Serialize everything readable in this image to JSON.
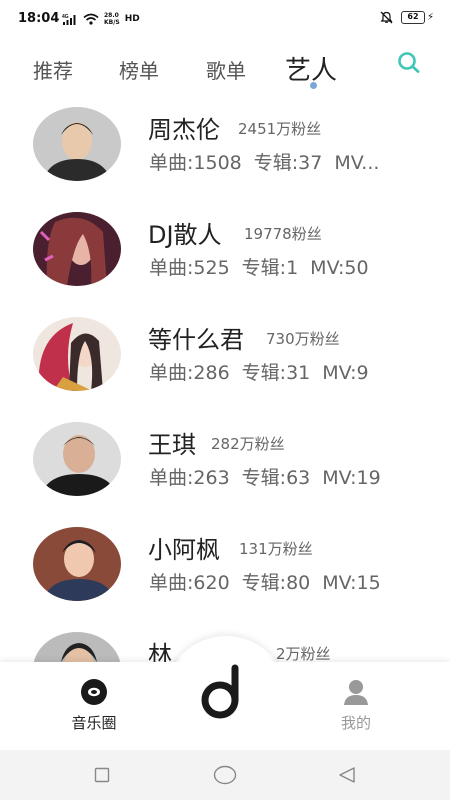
{
  "status_bar": {
    "time": "18:04",
    "network_type": "4G",
    "speed_value": "28.0",
    "speed_unit": "KB/S",
    "hd_label": "HD",
    "battery": "62"
  },
  "tabs": [
    {
      "label": "推荐",
      "active": false
    },
    {
      "label": "榜单",
      "active": false
    },
    {
      "label": "歌单",
      "active": false
    },
    {
      "label": "艺人",
      "active": true
    }
  ],
  "colors": {
    "accent": "#3ec6b6",
    "indicator_dot": "#7aa8d6",
    "inactive_nav": "#999999",
    "text_primary": "#222222",
    "text_secondary": "#666666"
  },
  "icons": {
    "search": "search-icon",
    "center": "music-note-logo-icon",
    "home": "vinyl-record-icon",
    "profile": "user-icon"
  },
  "artists": [
    {
      "name": "周杰伦",
      "fans": "2451万粉丝",
      "singles": "单曲:1508",
      "albums": "专辑:37",
      "mv": "MV..."
    },
    {
      "name": "DJ散人",
      "fans": "19778粉丝",
      "singles": "单曲:525",
      "albums": "专辑:1",
      "mv": "MV:50"
    },
    {
      "name": "等什么君",
      "fans": "730万粉丝",
      "singles": "单曲:286",
      "albums": "专辑:31",
      "mv": "MV:9"
    },
    {
      "name": "王琪",
      "fans": "282万粉丝",
      "singles": "单曲:263",
      "albums": "专辑:63",
      "mv": "MV:19"
    },
    {
      "name": "小阿枫",
      "fans": "131万粉丝",
      "singles": "单曲:620",
      "albums": "专辑:80",
      "mv": "MV:15"
    },
    {
      "name": "林",
      "fans": "2万粉丝"
    }
  ],
  "bottom_nav": {
    "home_label": "音乐圈",
    "profile_label": "我的"
  }
}
